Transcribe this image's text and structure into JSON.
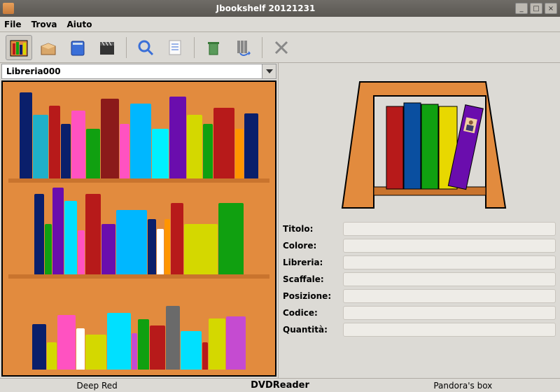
{
  "window": {
    "title": "Jbookshelf 20121231"
  },
  "menu": {
    "file": "File",
    "trova": "Trova",
    "aiuto": "Aiuto"
  },
  "toolbar_icons": [
    "library",
    "box",
    "book",
    "clapper",
    "search",
    "edit",
    "trash",
    "return",
    "delete"
  ],
  "library_selected": "Libreria000",
  "shelves": [
    [
      {
        "c": "#0a1f6b",
        "w": 18,
        "h": 95
      },
      {
        "c": "#1fb0c9",
        "w": 22,
        "h": 70
      },
      {
        "c": "#b71a1a",
        "w": 16,
        "h": 80
      },
      {
        "c": "#0a1f6b",
        "w": 14,
        "h": 60
      },
      {
        "c": "#ff52c1",
        "w": 20,
        "h": 75
      },
      {
        "c": "#10a010",
        "w": 20,
        "h": 55
      },
      {
        "c": "#8b1a1a",
        "w": 26,
        "h": 88
      },
      {
        "c": "#ff52c1",
        "w": 14,
        "h": 60
      },
      {
        "c": "#00b7ff",
        "w": 30,
        "h": 82
      },
      {
        "c": "#00f0ff",
        "w": 24,
        "h": 55
      },
      {
        "c": "#6a0dad",
        "w": 24,
        "h": 90
      },
      {
        "c": "#d4d800",
        "w": 22,
        "h": 70
      },
      {
        "c": "#10a010",
        "w": 14,
        "h": 60
      },
      {
        "c": "#b71a1a",
        "w": 30,
        "h": 78
      },
      {
        "c": "#ff9500",
        "w": 12,
        "h": 55
      },
      {
        "c": "#0a1f6b",
        "w": 20,
        "h": 72
      }
    ],
    [
      {
        "c": "#0a1f6b",
        "w": 14,
        "h": 88
      },
      {
        "c": "#10a010",
        "w": 10,
        "h": 55
      },
      {
        "c": "#6a0dad",
        "w": 16,
        "h": 95
      },
      {
        "c": "#00e0ff",
        "w": 18,
        "h": 80
      },
      {
        "c": "#ff52c1",
        "w": 10,
        "h": 48
      },
      {
        "c": "#b71a1a",
        "w": 22,
        "h": 88
      },
      {
        "c": "#6a0dad",
        "w": 20,
        "h": 55
      },
      {
        "c": "#00b7ff",
        "w": 44,
        "h": 70
      },
      {
        "c": "#0a1f6b",
        "w": 12,
        "h": 60
      },
      {
        "c": "#ffffff",
        "w": 10,
        "h": 50
      },
      {
        "c": "#ff9500",
        "w": 8,
        "h": 60
      },
      {
        "c": "#b71a1a",
        "w": 18,
        "h": 78
      },
      {
        "c": "#d4d800",
        "w": 48,
        "h": 55
      },
      {
        "c": "#10a010",
        "w": 36,
        "h": 78
      }
    ],
    [
      {
        "c": "#0a1f6b",
        "w": 20,
        "h": 50
      },
      {
        "c": "#d4d800",
        "w": 14,
        "h": 30
      },
      {
        "c": "#ff52c1",
        "w": 26,
        "h": 60
      },
      {
        "c": "#ffffff",
        "w": 12,
        "h": 45
      },
      {
        "c": "#d4d800",
        "w": 30,
        "h": 38
      },
      {
        "c": "#00e0ff",
        "w": 34,
        "h": 62
      },
      {
        "c": "#c54bd1",
        "w": 8,
        "h": 40
      },
      {
        "c": "#10a010",
        "w": 16,
        "h": 55
      },
      {
        "c": "#b71a1a",
        "w": 22,
        "h": 48
      },
      {
        "c": "#6a6a6a",
        "w": 20,
        "h": 70
      },
      {
        "c": "#00e0ff",
        "w": 30,
        "h": 42
      },
      {
        "c": "#b71a1a",
        "w": 8,
        "h": 30
      },
      {
        "c": "#d4d800",
        "w": 24,
        "h": 56
      },
      {
        "c": "#c54bd1",
        "w": 28,
        "h": 58
      }
    ]
  ],
  "fields": {
    "titolo": {
      "label": "Titolo:",
      "value": ""
    },
    "colore": {
      "label": "Colore:",
      "value": ""
    },
    "libreria": {
      "label": "Libreria:",
      "value": ""
    },
    "scaffale": {
      "label": "Scaffale:",
      "value": ""
    },
    "posizione": {
      "label": "Posizione:",
      "value": ""
    },
    "codice": {
      "label": "Codice:",
      "value": ""
    },
    "quantita": {
      "label": "Quantità:",
      "value": ""
    }
  },
  "status": {
    "left": "Deep Red",
    "center": "DVDReader",
    "right": "Pandora's box"
  }
}
